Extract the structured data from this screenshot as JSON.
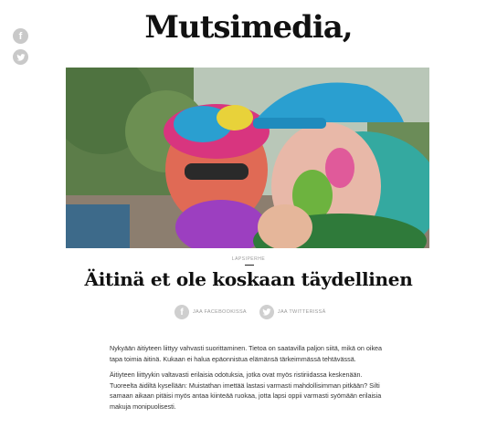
{
  "brand": {
    "logo_text": "Mutsimedia,"
  },
  "sidebar_social": {
    "icons": [
      "facebook-icon",
      "twitter-icon"
    ]
  },
  "hero": {
    "alt": ""
  },
  "article": {
    "kicker": "Lapsiperhe",
    "title": "Äitinä et ole koskaan täydellinen",
    "share": {
      "facebook_label": "JAA FACEBOOKISSA",
      "twitter_label": "JAA TWITTERISSÄ"
    },
    "paragraphs": [
      "Nykyään äitiyteen liittyy vahvasti suorittaminen. Tietoa on saatavilla paljon siitä, mikä on oikea tapa toimia äitinä. Kukaan ei halua epäonnistua elämänsä tärkeimmässä tehtävässä.",
      "Äitiyteen liittyykin valtavasti erilaisia odotuksia, jotka ovat myös ristiriidassa keskenään. Tuoreelta äidiltä kysellään: Muistathan imettää lastasi varmasti mahdollisimman pitkään? Silti samaan aikaan pitäisi myös antaa kiinteää ruokaa, jotta lapsi oppii varmasti syömään erilaisia makuja monipuolisesti."
    ]
  },
  "colors": {
    "text": "#222222",
    "muted": "#999999",
    "icon_bg": "#c9c9c9",
    "hat_blue": "#2a9fd0",
    "hat_pink": "#d8357f"
  }
}
